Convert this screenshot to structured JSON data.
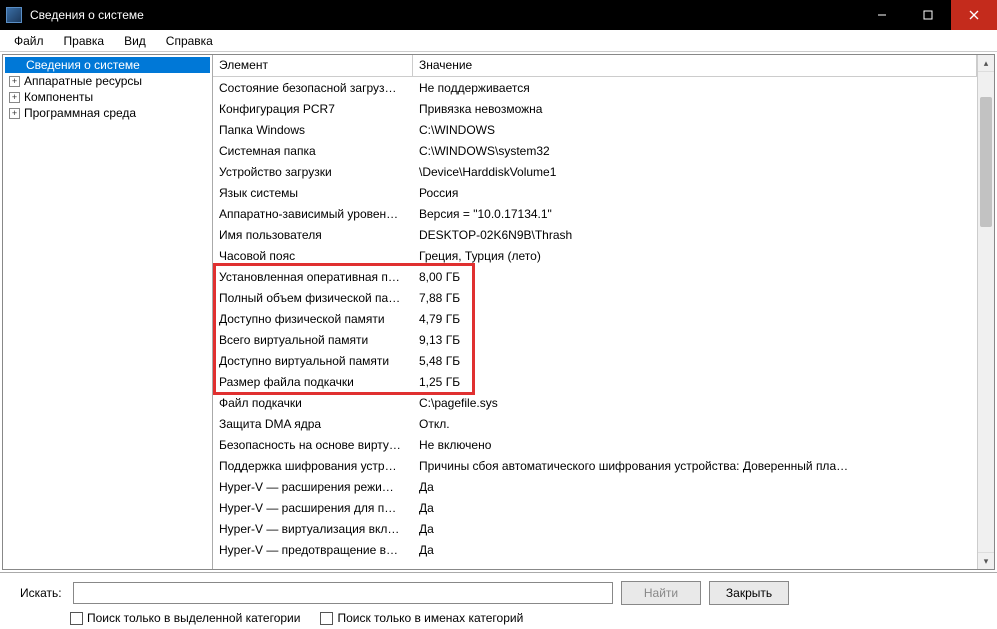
{
  "window": {
    "title": "Сведения о системе"
  },
  "menubar": [
    "Файл",
    "Правка",
    "Вид",
    "Справка"
  ],
  "tree": {
    "root": "Сведения о системе",
    "children": [
      "Аппаратные ресурсы",
      "Компоненты",
      "Программная среда"
    ]
  },
  "columns": {
    "element": "Элемент",
    "value": "Значение"
  },
  "rows": [
    {
      "elem": "Состояние безопасной загруз…",
      "val": "Не поддерживается"
    },
    {
      "elem": "Конфигурация PCR7",
      "val": "Привязка невозможна"
    },
    {
      "elem": "Папка Windows",
      "val": "C:\\WINDOWS"
    },
    {
      "elem": "Системная папка",
      "val": "C:\\WINDOWS\\system32"
    },
    {
      "elem": "Устройство загрузки",
      "val": "\\Device\\HarddiskVolume1"
    },
    {
      "elem": "Язык системы",
      "val": "Россия"
    },
    {
      "elem": "Аппаратно-зависимый уровен…",
      "val": "Версия = \"10.0.17134.1\""
    },
    {
      "elem": "Имя пользователя",
      "val": "DESKTOP-02K6N9B\\Thrash"
    },
    {
      "elem": "Часовой пояс",
      "val": "Греция, Турция (лето)"
    },
    {
      "elem": "Установленная оперативная п…",
      "val": "8,00 ГБ"
    },
    {
      "elem": "Полный объем физической па…",
      "val": "7,88 ГБ"
    },
    {
      "elem": "Доступно физической памяти",
      "val": "4,79 ГБ"
    },
    {
      "elem": "Всего виртуальной памяти",
      "val": "9,13 ГБ"
    },
    {
      "elem": "Доступно виртуальной памяти",
      "val": "5,48 ГБ"
    },
    {
      "elem": "Размер файла подкачки",
      "val": "1,25 ГБ"
    },
    {
      "elem": "Файл подкачки",
      "val": "C:\\pagefile.sys"
    },
    {
      "elem": "Защита DMA ядра",
      "val": "Откл."
    },
    {
      "elem": "Безопасность на основе вирту…",
      "val": "Не включено"
    },
    {
      "elem": "Поддержка шифрования устр…",
      "val": "Причины сбоя автоматического шифрования устройства: Доверенный пла…"
    },
    {
      "elem": "Hyper-V — расширения режи…",
      "val": "Да"
    },
    {
      "elem": "Hyper-V — расширения для п…",
      "val": "Да"
    },
    {
      "elem": "Hyper-V — виртуализация вкл…",
      "val": "Да"
    },
    {
      "elem": "Hyper-V — предотвращение в…",
      "val": "Да"
    }
  ],
  "highlight": {
    "startRow": 9,
    "endRow": 14
  },
  "search": {
    "label": "Искать:",
    "value": "",
    "find_btn": "Найти",
    "close_btn": "Закрыть",
    "chk1": "Поиск только в выделенной категории",
    "chk2": "Поиск только в именах категорий"
  }
}
